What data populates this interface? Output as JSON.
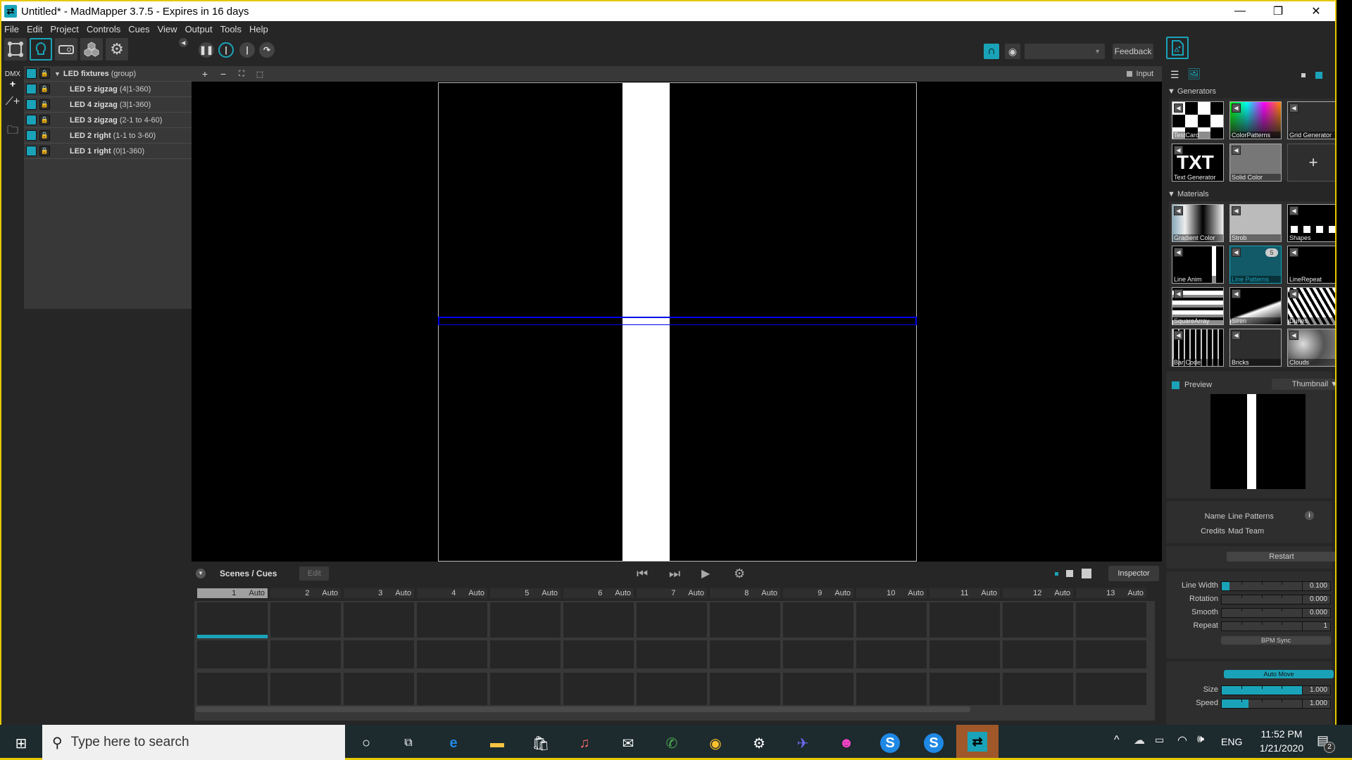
{
  "window": {
    "title": "Untitled* - MadMapper 3.7.5 - Expires in 16 days",
    "controls": {
      "minimize": "—",
      "restore": "❐",
      "close": "✕"
    }
  },
  "menu": [
    "File",
    "Edit",
    "Project",
    "Controls",
    "Cues",
    "View",
    "Output",
    "Tools",
    "Help"
  ],
  "toolbar": {
    "modes": [
      "surface-mode",
      "led-mode",
      "output-mode",
      "3d-mode",
      "settings-mode"
    ],
    "transport": [
      "pause",
      "play",
      "step",
      "loop"
    ],
    "feedback_label": "Feedback",
    "dropdown_value": ""
  },
  "fixtures": {
    "group": {
      "name": "LED fixtures",
      "sub": "(group)"
    },
    "items": [
      {
        "name": "LED 5 zigzag",
        "sub": "(4|1-360)"
      },
      {
        "name": "LED 4 zigzag",
        "sub": "(3|1-360)"
      },
      {
        "name": "LED 3 zigzag",
        "sub": "(2-1 to 4-60)"
      },
      {
        "name": "LED 2 right",
        "sub": "(1-1 to 3-60)"
      },
      {
        "name": "LED 1 right",
        "sub": "(0|1-360)"
      }
    ],
    "side_icons": {
      "dmx_label": "DMX"
    }
  },
  "canvas": {
    "tools": [
      "+",
      "−",
      "⛶",
      "⬚"
    ],
    "input_label": "Input"
  },
  "scenes": {
    "title": "Scenes / Cues",
    "edit_label": "Edit",
    "inspector_label": "Inspector",
    "cues": [
      {
        "num": "1",
        "mode": "Auto"
      },
      {
        "num": "2",
        "mode": "Auto"
      },
      {
        "num": "3",
        "mode": "Auto"
      },
      {
        "num": "4",
        "mode": "Auto"
      },
      {
        "num": "5",
        "mode": "Auto"
      },
      {
        "num": "6",
        "mode": "Auto"
      },
      {
        "num": "7",
        "mode": "Auto"
      },
      {
        "num": "8",
        "mode": "Auto"
      },
      {
        "num": "9",
        "mode": "Auto"
      },
      {
        "num": "10",
        "mode": "Auto"
      },
      {
        "num": "11",
        "mode": "Auto"
      },
      {
        "num": "12",
        "mode": "Auto"
      },
      {
        "num": "13",
        "mode": "Auto"
      }
    ]
  },
  "library": {
    "generators_title": "Generators",
    "generators": [
      "TestCard",
      "ColorPatterns",
      "Grid Generator",
      "Text Generator",
      "Solid Color"
    ],
    "materials_title": "Materials",
    "materials": [
      "Gradient Color",
      "Strob",
      "Shapes",
      "Line Anim",
      "Line Patterns",
      "LineRepeat",
      "SquareArray",
      "Siren",
      "Dunes",
      "Bar Code",
      "Bricks",
      "Clouds"
    ],
    "selected_badge": "5",
    "txt_label": "TXT",
    "add_label": "+"
  },
  "inspector": {
    "preview_label": "Preview",
    "preview_mode": "Thumbnail",
    "name_label": "Name",
    "name_value": "Line Patterns",
    "credits_label": "Credits",
    "credits_value": "Mad Team",
    "restart_label": "Restart",
    "params": [
      {
        "label": "Line Width",
        "value": "0.100",
        "fill": 0.1
      },
      {
        "label": "Rotation",
        "value": "0.000",
        "fill": 0
      },
      {
        "label": "Smooth",
        "value": "0.000",
        "fill": 0
      },
      {
        "label": "Repeat",
        "value": "1",
        "fill": 0
      }
    ],
    "bpm_label": "BPM Sync",
    "automove_label": "Auto Move",
    "params2": [
      {
        "label": "Size",
        "value": "1.000",
        "fill": 1.0
      },
      {
        "label": "Speed",
        "value": "1.000",
        "fill": 0.33
      }
    ]
  },
  "taskbar": {
    "search_placeholder": "Type here to search",
    "lang": "ENG",
    "time": "11:52 PM",
    "date": "1/21/2020",
    "notifications": "2"
  },
  "colors": {
    "accent": "#1aa3b8",
    "selection": "#0000ee"
  }
}
